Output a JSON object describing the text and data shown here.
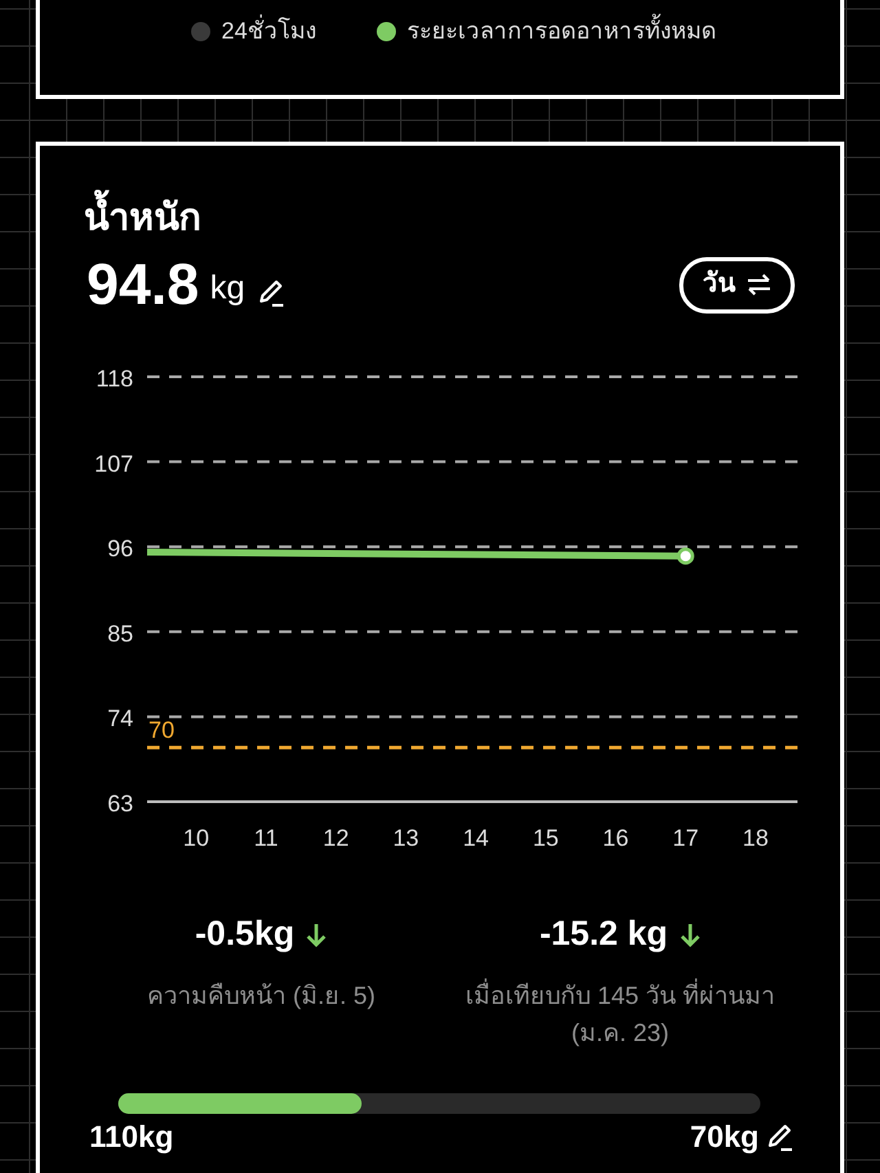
{
  "legend": [
    {
      "label": "24ชั่วโมง",
      "color": "#3a3a3a"
    },
    {
      "label": "ระยะเวลาการอดอาหารทั้งหมด",
      "color": "#7ecb63"
    }
  ],
  "weight_card": {
    "title": "น้ำหนัก",
    "value": "94.8",
    "unit": "kg",
    "period_button": "วัน",
    "chart_data": {
      "type": "line",
      "x": [
        9.3,
        17
      ],
      "series": [
        {
          "color": "#7ecb63",
          "values": [
            95.3,
            94.8
          ]
        }
      ],
      "xlim": [
        9.3,
        18.6
      ],
      "ylim": [
        63,
        118
      ],
      "xticks": [
        10,
        11,
        12,
        13,
        14,
        15,
        16,
        17,
        18
      ],
      "yticks": [
        63,
        74,
        85,
        96,
        107,
        118
      ],
      "grid": true,
      "ref_lines": [
        {
          "axis": "y",
          "value": 70,
          "label": "70",
          "color": "#f0a830"
        }
      ]
    },
    "stats": [
      {
        "value": "-0.5kg",
        "caption": "ความคืบหน้า (มิ.ย. 5)"
      },
      {
        "value": "-15.2 kg",
        "caption": "เมื่อเทียบกับ 145 วัน ที่ผ่านมา (ม.ค. 23)"
      }
    ],
    "progress": {
      "level": 0.38,
      "start": "110kg",
      "goal": "70kg"
    }
  }
}
